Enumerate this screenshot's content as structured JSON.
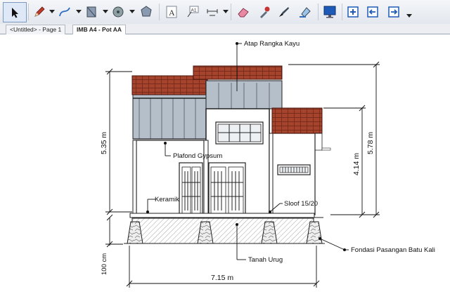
{
  "toolbar": {
    "tools": [
      {
        "name": "select-tool-icon"
      },
      {
        "name": "pencil-tool-icon"
      },
      {
        "name": "curve-tool-icon"
      },
      {
        "name": "rectangle-tool-icon"
      },
      {
        "name": "circle-tool-icon"
      },
      {
        "name": "polygon-tool-icon"
      },
      {
        "name": "text-tool-icon"
      },
      {
        "name": "label-tool-icon"
      },
      {
        "name": "dimension-tool-icon"
      },
      {
        "name": "eraser-tool-icon"
      },
      {
        "name": "eyedropper-tool-icon"
      },
      {
        "name": "style-tool-icon"
      },
      {
        "name": "fill-tool-icon"
      },
      {
        "name": "monitor-icon"
      },
      {
        "name": "add-viewport-icon"
      },
      {
        "name": "move-back-icon"
      },
      {
        "name": "move-forward-icon"
      }
    ]
  },
  "tabs": [
    {
      "label": "<Untitled> - Page 1",
      "active": false
    },
    {
      "label": "IMB A4 - Pot AA",
      "active": true
    }
  ],
  "drawing": {
    "labels": {
      "roof": "Atap Rangka Kayu",
      "ceiling": "Plafond Gypsum",
      "tile": "Keramik",
      "sloof": "Sloof 15/20",
      "fill_soil": "Tanah Urug",
      "foundation": "Fondasi Pasangan Batu Kali"
    },
    "dimensions": {
      "height_left": "5.35 m",
      "height_right": "5.78 m",
      "height_inner": "4.14 m",
      "foundation_depth": "100 cm",
      "width": "7.15 m"
    }
  },
  "colors": {
    "roof_tile": "#a5432c",
    "roof_tile_dark": "#7a2c1c",
    "glass": "#a8b4c0",
    "toolbar_bg": "#e8ecf2"
  }
}
